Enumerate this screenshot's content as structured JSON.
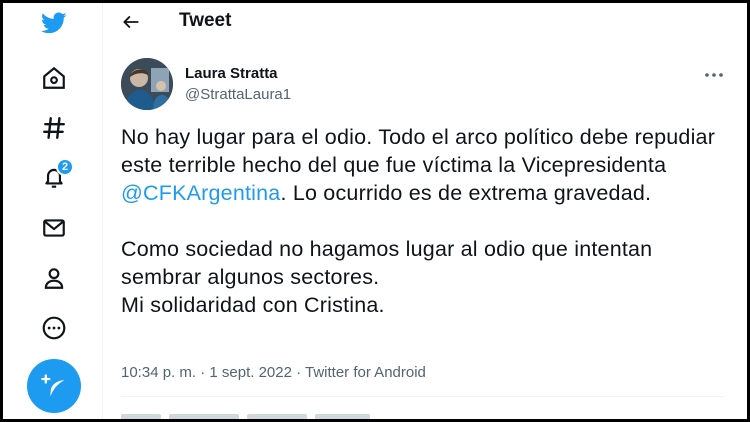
{
  "brand": {
    "color": "#1d9bf0",
    "logo_icon": "twitter-bird-icon"
  },
  "sidebar": {
    "items": [
      {
        "name": "home",
        "icon": "home-icon"
      },
      {
        "name": "explore",
        "icon": "hashtag-icon"
      },
      {
        "name": "notifications",
        "icon": "bell-icon",
        "badge": "2"
      },
      {
        "name": "messages",
        "icon": "mail-icon"
      },
      {
        "name": "profile",
        "icon": "person-icon"
      },
      {
        "name": "more",
        "icon": "more-circle-icon"
      }
    ],
    "compose_icon": "feather-plus-icon"
  },
  "header": {
    "back_icon": "arrow-left-icon",
    "title": "Tweet"
  },
  "tweet": {
    "author_name": "Laura Stratta",
    "author_handle": "@StrattaLaura1",
    "more_icon": "more-horizontal-icon",
    "text_part1": "No hay lugar para el odio. Todo el arco político debe repudiar este terrible hecho del que fue víctima la Vicepresidenta ",
    "mention": "@CFKArgentina",
    "text_part2": ". Lo ocurrido es de extrema gravedad.",
    "text_para2_line1": "Como sociedad no hagamos lugar al odio que intentan sembrar algunos sectores.",
    "text_para2_line2": "Mi solidaridad con Cristina.",
    "meta": "10:34 p. m. · 1 sept. 2022 · Twitter for Android"
  },
  "colors": {
    "text": "#0f1419",
    "secondary": "#536471",
    "accent": "#1d9bf0",
    "border": "#eff3f4"
  }
}
